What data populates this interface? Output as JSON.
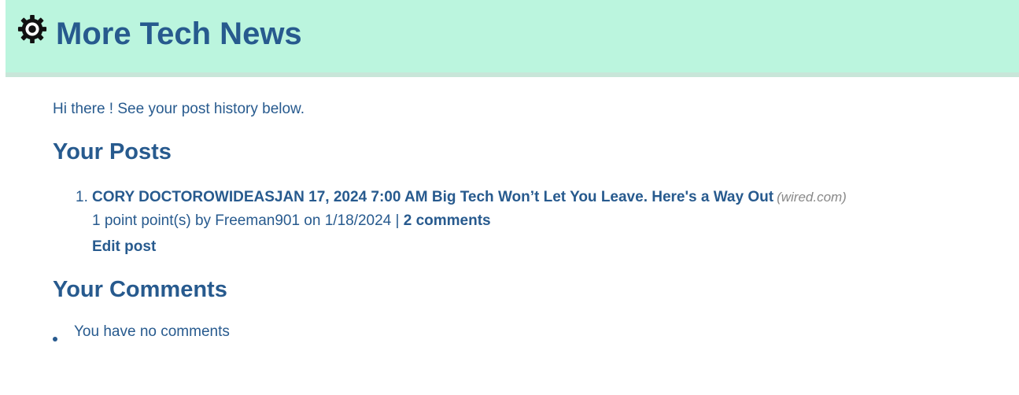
{
  "header": {
    "title": "More Tech News",
    "icon": "gear-icon"
  },
  "main": {
    "greeting": "Hi there ! See your post history below.",
    "posts_heading": "Your Posts",
    "posts": [
      {
        "number": "1.",
        "title": "CORY DOCTOROWIDEASJAN 17, 2024 7:00 AM Big Tech Won’t Let You Leave. Here's a Way Out",
        "domain": "(wired.com)",
        "meta_prefix": "1 point point(s) by Freeman901 on 1/18/2024 |",
        "comments_link": "2 comments",
        "edit_label": "Edit post"
      }
    ],
    "comments_heading": "Your Comments",
    "no_comments": "You have no comments"
  },
  "colors": {
    "header_bg": "#bbf5de",
    "text": "#275a8e",
    "domain": "#888888"
  }
}
